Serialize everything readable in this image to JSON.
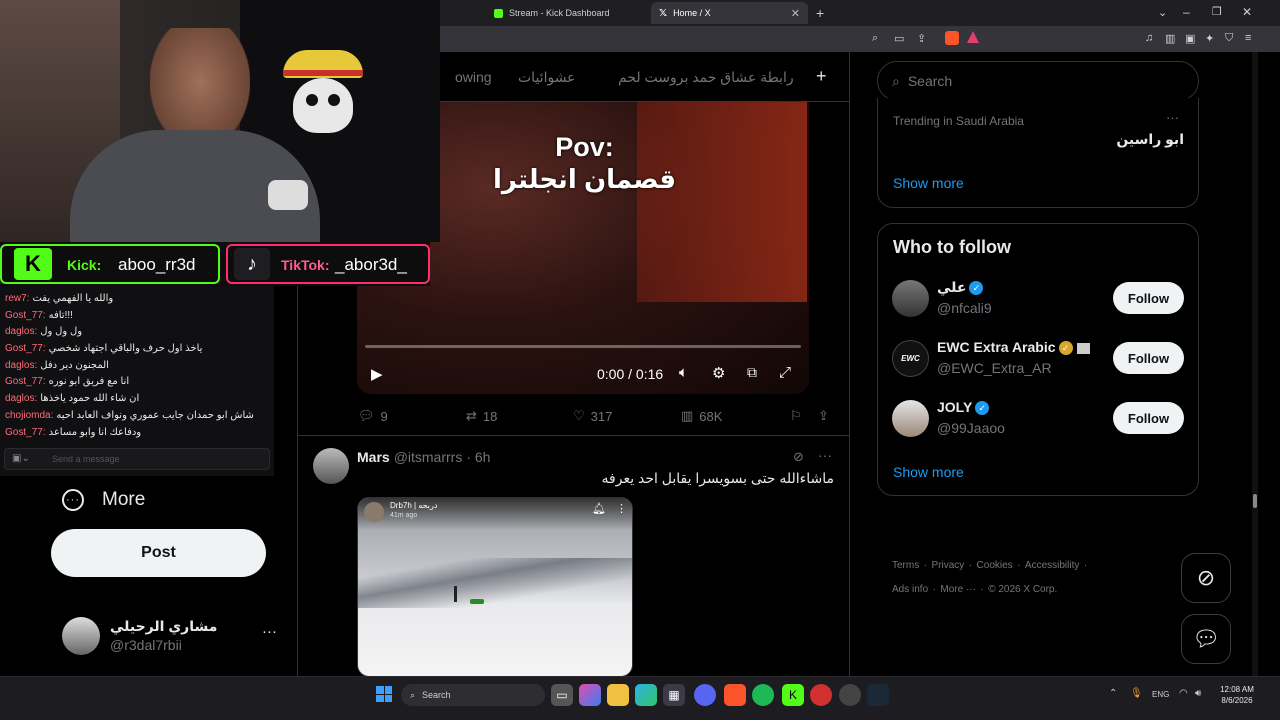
{
  "browser": {
    "tabs": [
      {
        "label": "Stream - Kick Dashboard",
        "icon": "kick-icon"
      },
      {
        "label": "Home / X",
        "icon": "x-logo-icon"
      }
    ],
    "new_tab": "+"
  },
  "overlay": {
    "kick_label": "Kick:",
    "kick_handle": "aboo_rr3d",
    "tiktok_label": "TikTok:",
    "tiktok_handle": "_abor3d_",
    "chat": [
      {
        "user": "rew7:",
        "msg": "والله يا الفهمي يفت",
        "color": "#ff6b7a"
      },
      {
        "user": "Gost_77:",
        "msg": "تافه!!!",
        "color": "#ff6b7a"
      },
      {
        "user": "daglos:",
        "msg": "ول ول ول",
        "color": "#ff6b7a"
      },
      {
        "user": "Gost_77:",
        "msg": "ياخذ اول حرف والباقي اجتهاد شخصي",
        "color": "#ff6b7a"
      },
      {
        "user": "daglos:",
        "msg": "المجنون دير دفل",
        "color": "#ff6b7a"
      },
      {
        "user": "Gost_77:",
        "msg": "انا مع فريق ابو نوره",
        "color": "#ff6b7a"
      },
      {
        "user": "daglos:",
        "msg": "ان شاء الله حمود ياخذها",
        "color": "#ff6b7a"
      },
      {
        "user": "chojiomda:",
        "msg": "شاش ابو حمدان جايب عموري ونواف العابد احيه",
        "color": "#ff6b7a"
      },
      {
        "user": "Gost_77:",
        "msg": "ودفاعك انا وابو مساعد",
        "color": "#ff6b7a"
      }
    ],
    "send_placeholder": "Send a message"
  },
  "x": {
    "top_tabs": [
      {
        "label": "owing"
      },
      {
        "label": "عشوائيات"
      },
      {
        "label": "رابطة عشاق حمد بروست لحم"
      }
    ],
    "add_tab": "+",
    "nav": {
      "more_label": "More",
      "post_label": "Post"
    },
    "profile": {
      "name": "مشاري الرحيلي",
      "handle": "@r3dal7rbii",
      "menu": "···"
    },
    "tweet1": {
      "video_caption_line1": "Pov:",
      "video_caption_line2": "قصمان انجلترا",
      "time": "0:00 / 0:16",
      "progress": 0,
      "replies": "9",
      "retweets": "18",
      "likes": "317",
      "views": "68K"
    },
    "tweet2": {
      "name": "Mars",
      "handle": "@itsmarrrs",
      "time": "· 6h",
      "text": "ماشاءالله حتى بسويسرا يقابل احد يعرفه",
      "embed_name": "Drb7h | دربحه",
      "embed_time": "41m ago"
    },
    "search_placeholder": "Search",
    "trending": {
      "context": "Trending in Saudi Arabia",
      "topic": "ابو راسين",
      "show_more": "Show more",
      "menu": "···"
    },
    "who_to_follow": {
      "title": "Who to follow",
      "users": [
        {
          "name": "علي",
          "handle": "@nfcali9",
          "button": "Follow",
          "badge": "blue"
        },
        {
          "name": "EWC Extra Arabic",
          "handle": "@EWC_Extra_AR",
          "button": "Follow",
          "badge": "gold",
          "avatar_text": "EWC"
        },
        {
          "name": "JOLY",
          "handle": "@99Jaaoo",
          "button": "Follow",
          "badge": "blue"
        }
      ],
      "show_more": "Show more"
    },
    "footer": {
      "links": [
        "Terms",
        "Privacy",
        "Cookies",
        "Accessibility",
        "Ads info",
        "More ···"
      ],
      "copyright": "© 2026 X Corp."
    }
  },
  "taskbar": {
    "search_placeholder": "Search",
    "lang": "ENG",
    "time": "12:08 AM",
    "date": "8/6/2026"
  },
  "colors": {
    "x_blue": "#1d9bf0",
    "kick_green": "#53fc18",
    "tiktok_pink": "#ff2d6f",
    "chat_user": "#ff6b7a"
  }
}
